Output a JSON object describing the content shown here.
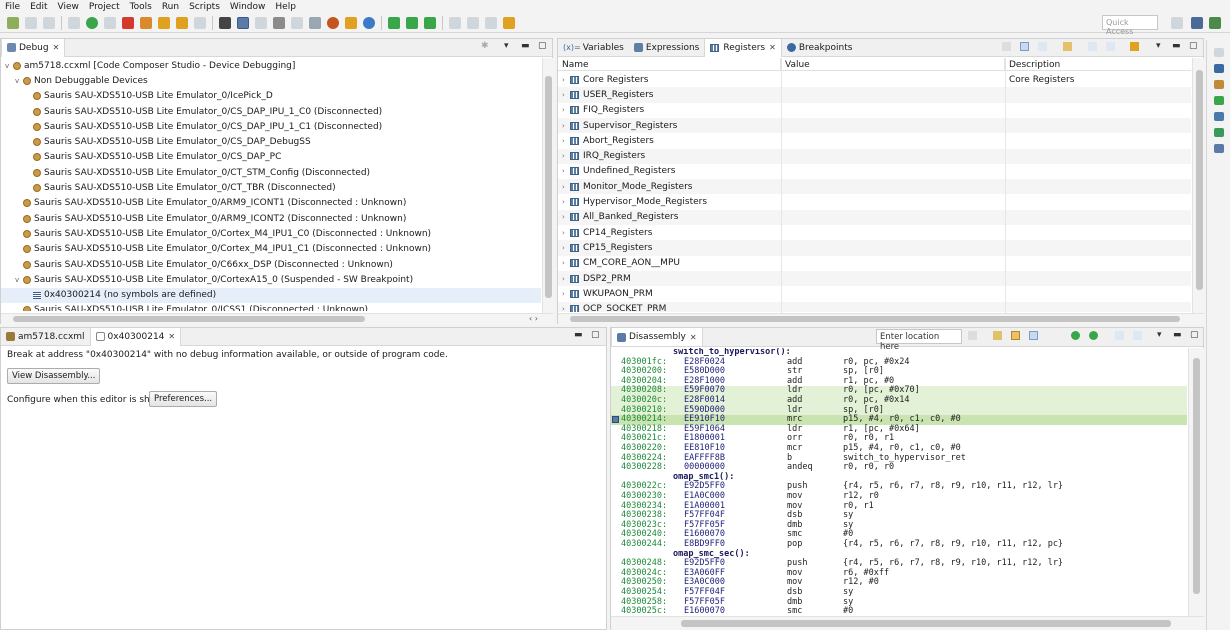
{
  "menu": [
    "File",
    "Edit",
    "View",
    "Project",
    "Tools",
    "Run",
    "Scripts",
    "Window",
    "Help"
  ],
  "toolbar": {
    "quick_access_placeholder": "Quick Access"
  },
  "debug_view": {
    "tab": "Debug",
    "rows": [
      {
        "text": "am5718.ccxml [Code Composer Studio - Device Debugging]",
        "level": 0,
        "expand": "v"
      },
      {
        "text": "Non Debuggable Devices",
        "level": 1,
        "expand": "v"
      },
      {
        "text": "Sauris SAU-XDS510-USB Lite Emulator_0/IcePick_D",
        "level": 2,
        "expand": ""
      },
      {
        "text": "Sauris SAU-XDS510-USB Lite Emulator_0/CS_DAP_IPU_1_C0  (Disconnected)",
        "level": 2,
        "expand": ""
      },
      {
        "text": "Sauris SAU-XDS510-USB Lite Emulator_0/CS_DAP_IPU_1_C1  (Disconnected)",
        "level": 2,
        "expand": ""
      },
      {
        "text": "Sauris SAU-XDS510-USB Lite Emulator_0/CS_DAP_DebugSS",
        "level": 2,
        "expand": ""
      },
      {
        "text": "Sauris SAU-XDS510-USB Lite Emulator_0/CS_DAP_PC",
        "level": 2,
        "expand": ""
      },
      {
        "text": "Sauris SAU-XDS510-USB Lite Emulator_0/CT_STM_Config  (Disconnected)",
        "level": 2,
        "expand": ""
      },
      {
        "text": "Sauris SAU-XDS510-USB Lite Emulator_0/CT_TBR  (Disconnected)",
        "level": 2,
        "expand": ""
      },
      {
        "text": "Sauris SAU-XDS510-USB Lite Emulator_0/ARM9_ICONT1 (Disconnected : Unknown)",
        "level": 1,
        "expand": ""
      },
      {
        "text": "Sauris SAU-XDS510-USB Lite Emulator_0/ARM9_ICONT2 (Disconnected : Unknown)",
        "level": 1,
        "expand": ""
      },
      {
        "text": "Sauris SAU-XDS510-USB Lite Emulator_0/Cortex_M4_IPU1_C0 (Disconnected : Unknown)",
        "level": 1,
        "expand": ""
      },
      {
        "text": "Sauris SAU-XDS510-USB Lite Emulator_0/Cortex_M4_IPU1_C1 (Disconnected : Unknown)",
        "level": 1,
        "expand": ""
      },
      {
        "text": "Sauris SAU-XDS510-USB Lite Emulator_0/C66xx_DSP (Disconnected : Unknown)",
        "level": 1,
        "expand": ""
      },
      {
        "text": "Sauris SAU-XDS510-USB Lite Emulator_0/CortexA15_0 (Suspended - SW Breakpoint)",
        "level": 1,
        "expand": "v"
      },
      {
        "text": "0x40300214  (no symbols are defined)",
        "level": 2,
        "expand": "",
        "selected": true
      },
      {
        "text": "Sauris SAU-XDS510-USB Lite Emulator_0/ICSS1 (Disconnected : Unknown)",
        "level": 1,
        "expand": ""
      }
    ]
  },
  "registers_view": {
    "tabs": [
      "Variables",
      "Expressions",
      "Registers",
      "Breakpoints"
    ],
    "columns": [
      "Name",
      "Value",
      "Description"
    ],
    "rows": [
      {
        "name": "Core Registers",
        "desc": "Core Registers"
      },
      {
        "name": "USER_Registers",
        "desc": ""
      },
      {
        "name": "FIQ_Registers",
        "desc": ""
      },
      {
        "name": "Supervisor_Registers",
        "desc": ""
      },
      {
        "name": "Abort_Registers",
        "desc": ""
      },
      {
        "name": "IRQ_Registers",
        "desc": ""
      },
      {
        "name": "Undefined_Registers",
        "desc": ""
      },
      {
        "name": "Monitor_Mode_Registers",
        "desc": ""
      },
      {
        "name": "Hypervisor_Mode_Registers",
        "desc": ""
      },
      {
        "name": "All_Banked_Registers",
        "desc": ""
      },
      {
        "name": "CP14_Registers",
        "desc": ""
      },
      {
        "name": "CP15_Registers",
        "desc": ""
      },
      {
        "name": "CM_CORE_AON__MPU",
        "desc": ""
      },
      {
        "name": "DSP2_PRM",
        "desc": ""
      },
      {
        "name": "WKUPAON_PRM",
        "desc": ""
      },
      {
        "name": "OCP_SOCKET_PRM",
        "desc": ""
      }
    ]
  },
  "editor": {
    "tabs": [
      "am5718.ccxml",
      "0x40300214"
    ],
    "message": "Break at address \"0x40300214\" with no debug information available, or outside of program code.",
    "view_disassembly": "View Disassembly...",
    "configure_text": "Configure when this editor is shown",
    "preferences": "Preferences..."
  },
  "disassembly": {
    "tab": "Disassembly",
    "location_placeholder": "Enter location here",
    "lines": [
      {
        "label": "switch_to_hypervisor():"
      },
      {
        "addr": "403001fc:",
        "op": "E28F0024",
        "mn": "add",
        "args": "r0, pc, #0x24"
      },
      {
        "addr": "40300200:",
        "op": "E580D000",
        "mn": "str",
        "args": "sp, [r0]"
      },
      {
        "addr": "40300204:",
        "op": "E28F1000",
        "mn": "add",
        "args": "r1, pc, #0"
      },
      {
        "addr": "40300208:",
        "op": "E59F0070",
        "mn": "ldr",
        "args": "r0, [pc, #0x70]",
        "hl": "light"
      },
      {
        "addr": "4030020c:",
        "op": "E28F0014",
        "mn": "add",
        "args": "r0, pc, #0x14",
        "hl": "light"
      },
      {
        "addr": "40300210:",
        "op": "E590D000",
        "mn": "ldr",
        "args": "sp, [r0]",
        "hl": "light"
      },
      {
        "addr": "40300214:",
        "op": "EE910F10",
        "mn": "mrc",
        "args": "p15, #4, r0, c1, c0, #0",
        "hl": "current"
      },
      {
        "addr": "40300218:",
        "op": "E59F1064",
        "mn": "ldr",
        "args": "r1, [pc, #0x64]"
      },
      {
        "addr": "4030021c:",
        "op": "E1800001",
        "mn": "orr",
        "args": "r0, r0, r1"
      },
      {
        "addr": "40300220:",
        "op": "EE810F10",
        "mn": "mcr",
        "args": "p15, #4, r0, c1, c0, #0"
      },
      {
        "addr": "40300224:",
        "op": "EAFFFF8B",
        "mn": "b",
        "args": "switch_to_hypervisor_ret"
      },
      {
        "addr": "40300228:",
        "op": "00000000",
        "mn": "andeq",
        "args": "r0, r0, r0"
      },
      {
        "label": "omap_smc1():"
      },
      {
        "addr": "4030022c:",
        "op": "E92D5FF0",
        "mn": "push",
        "args": "{r4, r5, r6, r7, r8, r9, r10, r11, r12, lr}"
      },
      {
        "addr": "40300230:",
        "op": "E1A0C000",
        "mn": "mov",
        "args": "r12, r0"
      },
      {
        "addr": "40300234:",
        "op": "E1A00001",
        "mn": "mov",
        "args": "r0, r1"
      },
      {
        "addr": "40300238:",
        "op": "F57FF04F",
        "mn": "dsb",
        "args": "sy"
      },
      {
        "addr": "4030023c:",
        "op": "F57FF05F",
        "mn": "dmb",
        "args": "sy"
      },
      {
        "addr": "40300240:",
        "op": "E1600070",
        "mn": "smc",
        "args": "#0"
      },
      {
        "addr": "40300244:",
        "op": "E8BD9FF0",
        "mn": "pop",
        "args": "{r4, r5, r6, r7, r8, r9, r10, r11, r12, pc}"
      },
      {
        "label": "omap_smc_sec():"
      },
      {
        "addr": "40300248:",
        "op": "E92D5FF0",
        "mn": "push",
        "args": "{r4, r5, r6, r7, r8, r9, r10, r11, r12, lr}"
      },
      {
        "addr": "4030024c:",
        "op": "E3A060FF",
        "mn": "mov",
        "args": "r6, #0xff"
      },
      {
        "addr": "40300250:",
        "op": "E3A0C000",
        "mn": "mov",
        "args": "r12, #0"
      },
      {
        "addr": "40300254:",
        "op": "F57FF04F",
        "mn": "dsb",
        "args": "sy"
      },
      {
        "addr": "40300258:",
        "op": "F57FF05F",
        "mn": "dmb",
        "args": "sy"
      },
      {
        "addr": "4030025c:",
        "op": "E1600070",
        "mn": "smc",
        "args": "#0"
      }
    ]
  },
  "colors": {
    "accent": "#3875d7",
    "address": "#1f8a3a",
    "current_line": "#c9e4b0",
    "light_line": "#e3f1d6"
  }
}
